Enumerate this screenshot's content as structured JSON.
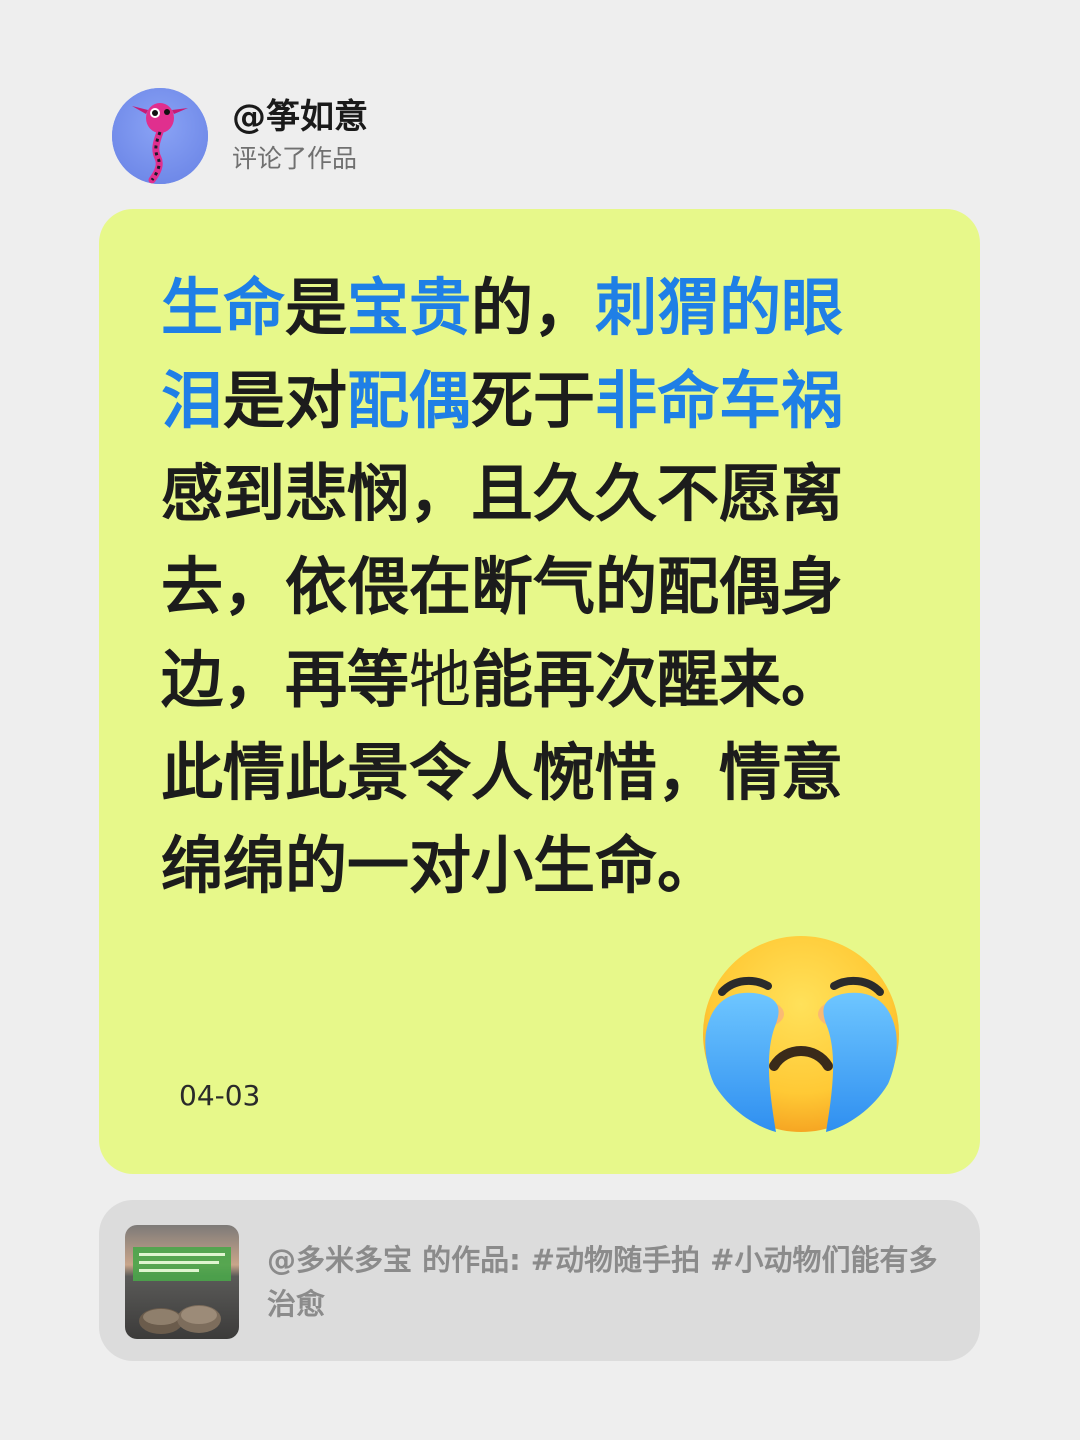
{
  "user": {
    "name": "@筝如意",
    "action": "评论了作品"
  },
  "comment": {
    "segments": [
      {
        "text": "生命",
        "highlight": true
      },
      {
        "text": "是",
        "highlight": false
      },
      {
        "text": "宝贵",
        "highlight": true
      },
      {
        "text": "的，",
        "highlight": false
      },
      {
        "text": "刺猬的眼泪",
        "highlight": true
      },
      {
        "text": "是对",
        "highlight": false
      },
      {
        "text": "配偶",
        "highlight": true
      },
      {
        "text": "死于",
        "highlight": false
      },
      {
        "text": "非命车祸",
        "highlight": true
      },
      {
        "text": "感到悲悯，且久久不愿离去，依偎在断气的配偶身边，再等",
        "highlight": false
      },
      {
        "text": "牠",
        "highlight": false,
        "light": true
      },
      {
        "text": "能再次醒来。此情此景令人惋惜，情意绵绵的一对小生命。",
        "highlight": false
      }
    ],
    "date": "04-03",
    "emoji_icon": "loudly-crying-face"
  },
  "reference": {
    "text": "@多米多宝 的作品: #动物随手拍 #小动物们能有多治愈",
    "thumb_icon": "hedgehog-photo"
  },
  "colors": {
    "background": "#eeeeee",
    "card": "#e7f88a",
    "highlight": "#1f7fe6",
    "reference_bg": "#dcdcdc"
  }
}
